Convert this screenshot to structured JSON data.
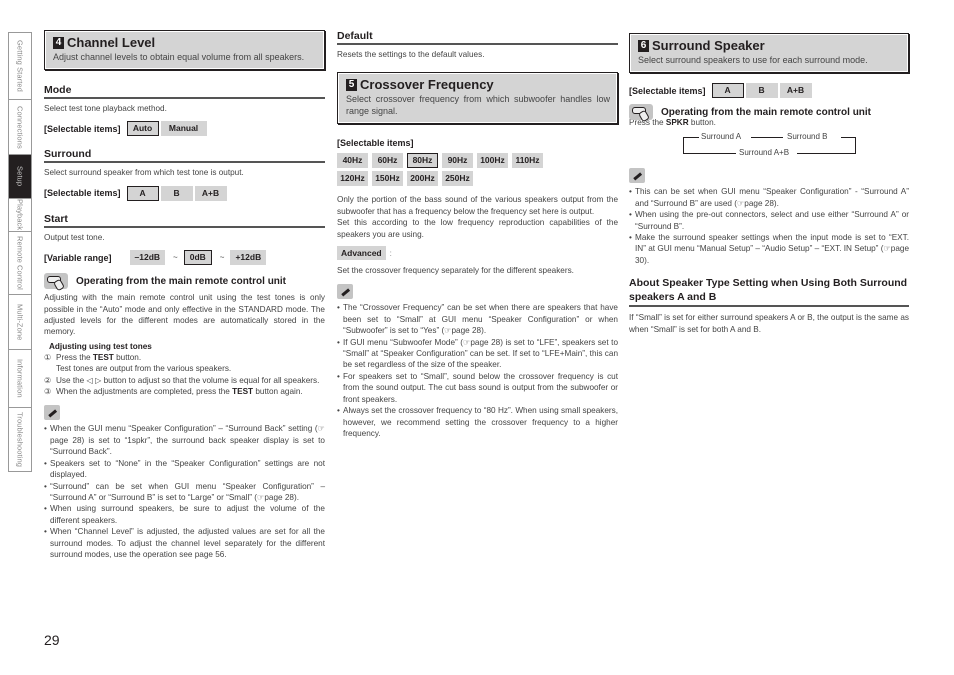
{
  "side_tabs": [
    {
      "label": "Getting Started",
      "active": false
    },
    {
      "label": "Connections",
      "active": false
    },
    {
      "label": "Setup",
      "active": true
    },
    {
      "label": "Playback",
      "active": false
    },
    {
      "label": "Remote Control",
      "active": false
    },
    {
      "label": "Multi-Zone",
      "active": false
    },
    {
      "label": "Information",
      "active": false
    },
    {
      "label": "Troubleshooting",
      "active": false
    }
  ],
  "col1": {
    "section": {
      "number": "4",
      "title": "Channel Level",
      "desc": "Adjust channel levels to obtain equal volume from all speakers."
    },
    "mode": {
      "heading": "Mode",
      "desc": "Select test tone playback method.",
      "sel_label": "[Selectable items]",
      "items": [
        "Auto",
        "Manual"
      ]
    },
    "surround": {
      "heading": "Surround",
      "desc": "Select surround speaker from which test tone is output.",
      "sel_label": "[Selectable items]",
      "items": [
        "A",
        "B",
        "A+B"
      ]
    },
    "start": {
      "heading": "Start",
      "desc": "Output test tone.",
      "range_label": "[Variable range]",
      "min": "–12dB",
      "value": "0dB",
      "max": "+12dB",
      "tilde": "~"
    },
    "operating": {
      "heading": "Operating from the main remote control unit",
      "desc": "Adjusting with the main remote control unit using the test tones is only possible in the “Auto” mode and only effective in the STANDARD mode. The adjusted levels for the different modes are automatically stored in the memory.",
      "steps_title": "Adjusting using test tones",
      "steps": [
        {
          "num": "①",
          "pre": "Press the ",
          "bold": "TEST",
          "post": " button.",
          "sub": "Test tones are output from the various speakers."
        },
        {
          "num": "②",
          "pre": "Use the ◁ ▷ button to adjust so that the volume is equal for all speakers.",
          "bold": "",
          "post": "",
          "sub": ""
        },
        {
          "num": "③",
          "pre": "When the adjustments are completed, press the ",
          "bold": "TEST",
          "post": " button again.",
          "sub": ""
        }
      ]
    },
    "notes": [
      "When the GUI menu “Speaker Configuration” – “Surround Back” setting (☞page 28) is set to “1spkr”, the surround back speaker display is set to “Surround Back”.",
      "Speakers set to “None” in the “Speaker Configuration” settings are not displayed.",
      "“Surround” can be set when GUI menu “Speaker Configuration” – “Surround A” or “Surround B” is set to “Large” or “Small” (☞page 28).",
      "When using surround speakers, be sure to adjust the volume of the different speakers.",
      "When “Channel Level” is adjusted, the adjusted values are set for all the surround modes. To adjust the channel level separately for the different surround modes, use the operation see page 56."
    ]
  },
  "col2": {
    "default": {
      "heading": "Default",
      "desc": "Resets the settings to the default values."
    },
    "section": {
      "number": "5",
      "title": "Crossover Frequency",
      "desc": "Select crossover frequency from which subwoofer handles low range signal."
    },
    "sel_label": "[Selectable items]",
    "frequencies": [
      "40Hz",
      "60Hz",
      "80Hz",
      "90Hz",
      "100Hz",
      "110Hz",
      "120Hz",
      "150Hz",
      "200Hz",
      "250Hz"
    ],
    "selected_frequency": "80Hz",
    "desc1": "Only the portion of the bass sound of the various speakers output from the subwoofer that has a frequency below the frequency set here is output.",
    "desc2": "Set this according to the low frequency reproduction capabilities of the speakers you are using.",
    "advanced": {
      "label": "Advanced",
      "colon": ":",
      "desc": "Set the crossover frequency separately for the different speakers."
    },
    "notes": [
      "The “Crossover Frequency” can be set when there are speakers that have been set to “Small” at GUI menu “Speaker Configuration” or when “Subwoofer” is set to “Yes” (☞page 28).",
      "If GUI menu “Subwoofer Mode” (☞page 28) is set to “LFE”, speakers set to “Small” at “Speaker Configuration” can be set. If set to “LFE+Main”, this can be set regardless of the size of the speaker.",
      "For speakers set to “Small”, sound below the crossover frequency is cut from the sound output. The cut bass sound is output from the subwoofer or front speakers.",
      "Always set the crossover frequency to “80 Hz”. When using small speakers, however, we recommend setting the crossover frequency to a higher frequency."
    ]
  },
  "col3": {
    "section": {
      "number": "6",
      "title": "Surround Speaker",
      "desc": "Select surround speakers to use for each surround mode."
    },
    "sel_label": "[Selectable items]",
    "items": [
      "A",
      "B",
      "A+B"
    ],
    "operating": {
      "heading": "Operating from the main remote control unit",
      "pre": "Press the ",
      "bold": "SPKR",
      "post": " button.",
      "cycle": [
        "Surround A",
        "Surround B",
        "Surround A+B"
      ]
    },
    "notes": [
      "This can be set when GUI menu “Speaker Configuration” - “Surround A” and “Surround B” are used (☞page 28).",
      "When using the pre-out connectors, select and use either “Surround A” or “Surround B”.",
      "Make the surround speaker settings when the input mode is set to “EXT. IN” at GUI menu “Manual Setup” – “Audio Setup” – “EXT. IN Setup” (☞page 30)."
    ],
    "about": {
      "heading": "About Speaker Type Setting when Using Both Surround speakers A and B",
      "desc": "If “Small” is set for either surround speakers A or B, the output is the same as when “Small” is set for both A and B."
    }
  },
  "page_number": "29"
}
